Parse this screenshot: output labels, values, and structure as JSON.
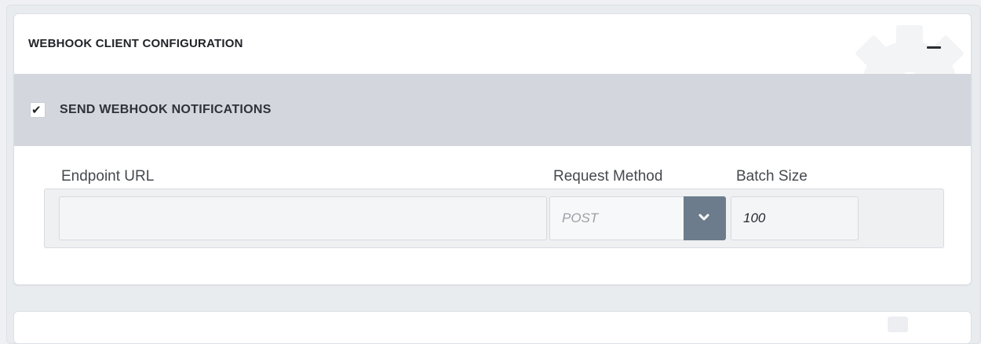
{
  "panel": {
    "title": "WEBHOOK CLIENT CONFIGURATION",
    "collapse_icon": "minus-icon",
    "background_icon": "gear-icon"
  },
  "notifications": {
    "checkbox_checked": true,
    "label": "SEND WEBHOOK NOTIFICATIONS"
  },
  "form": {
    "endpoint_url": {
      "label": "Endpoint URL",
      "value": ""
    },
    "request_method": {
      "label": "Request Method",
      "selected": "POST",
      "dropdown_icon": "chevron-down-icon"
    },
    "batch_size": {
      "label": "Batch Size",
      "value": "100"
    }
  },
  "colors": {
    "band": "#d3d7dd",
    "dropdown_button": "#6c7c8c"
  }
}
